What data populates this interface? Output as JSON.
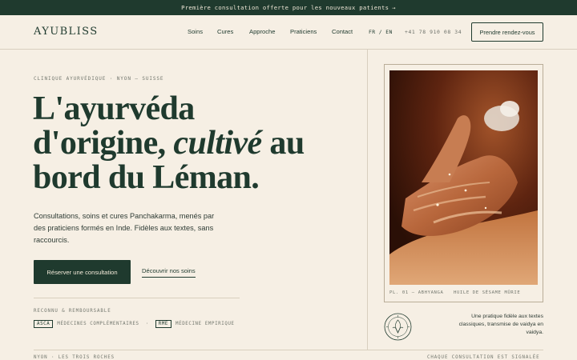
{
  "announcement": {
    "text": "Première consultation offerte pour les nouveaux patients",
    "icon": "arrow-icon"
  },
  "header": {
    "logo": "AYUBLISS",
    "nav": [
      "Soins",
      "Cures",
      "Approche",
      "Praticiens",
      "Contact"
    ],
    "language": "FR / EN",
    "phone": "+41 78 910 08 34",
    "cta_label": "Prendre rendez-vous"
  },
  "hero": {
    "eyebrow": "CLINIQUE AYURVÉDIQUE · NYON — SUISSE",
    "headline_line1": "L'ayurvéda",
    "headline_line2_a": "d'origine, ",
    "headline_line2_em": "cultivé",
    "headline_line2_b": " au",
    "headline_line3": "bord du Léman.",
    "lede": "Consultations, soins et cures Panchakarma, menés par des praticiens formés en Inde. Fidèles aux textes, sans raccourcis.",
    "primary_cta": "Réserver une consultation",
    "secondary_cta": "Découvrir nos soins"
  },
  "recognition": {
    "label": "RECONNU & REMBOURSABLE",
    "badges": [
      {
        "tag": "ASCA",
        "text": "MÉDECINES COMPLÉMENTAIRES"
      },
      {
        "tag": "RME",
        "text": "MÉDECINE EMPIRIQUE"
      }
    ],
    "separator": "·"
  },
  "figure": {
    "caption_left": "PL. 01 — ABHYANGA",
    "caption_right": "HUILE DE SÉSAME MÛRIE",
    "seal_icon": "seal-emblem-icon",
    "quote": "Une pratique fidèle aux textes classiques, transmise de vaidya en vaidya."
  },
  "footer": {
    "left": "NYON · LES TROIS ROCHES",
    "right": "CHAQUE CONSULTATION EST SIGNALÉE"
  },
  "colors": {
    "primary": "#1f3a2e",
    "background": "#f6efe4",
    "rule": "#d8cfbf",
    "muted": "#74786f"
  }
}
